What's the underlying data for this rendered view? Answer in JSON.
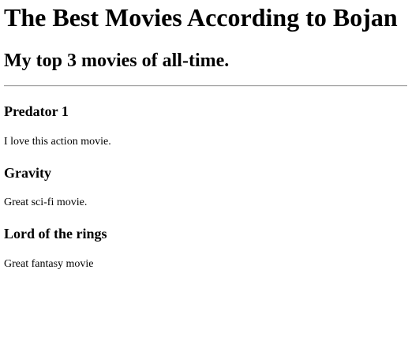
{
  "header": {
    "title": "The Best Movies According to Bojan",
    "subtitle": "My top 3 movies of all-time."
  },
  "movies": [
    {
      "title": "Predator 1",
      "description": "I love this action movie."
    },
    {
      "title": "Gravity",
      "description": "Great sci-fi movie."
    },
    {
      "title": "Lord of the rings",
      "description": "Great fantasy movie"
    }
  ]
}
